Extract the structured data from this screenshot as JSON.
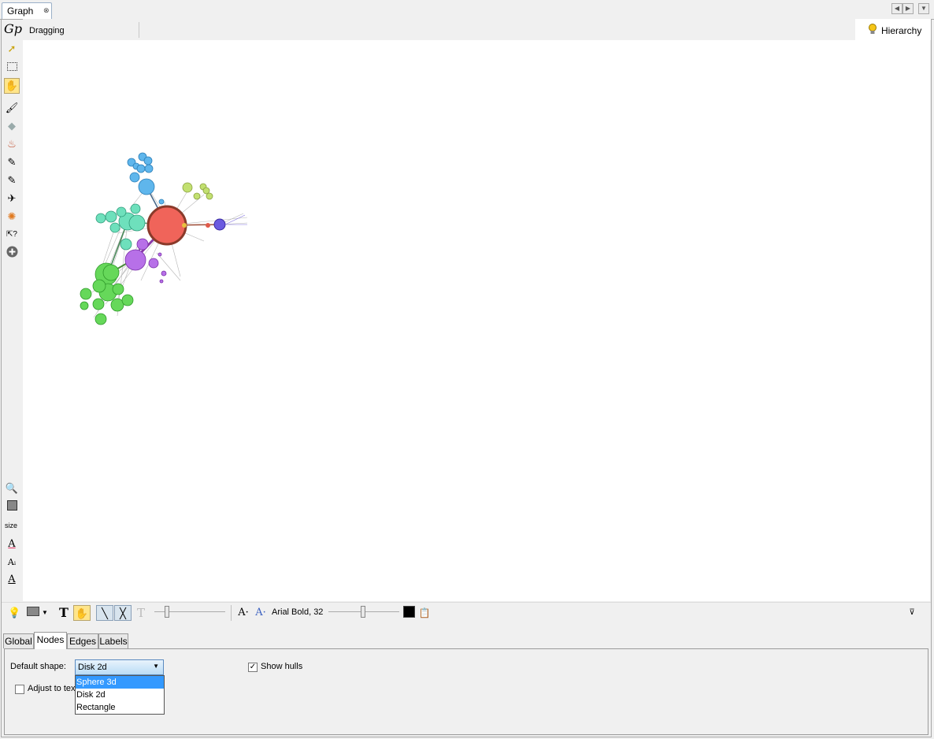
{
  "window": {
    "tab_label": "Graph",
    "close_glyph": "⊗"
  },
  "status": {
    "mode": "Dragging",
    "hierarchy_label": "Hierarchy"
  },
  "left_toolbar": {
    "logo": "Gp",
    "size_label": "size",
    "tools": [
      "pointer-icon",
      "rect-select-icon",
      "drag-hand-icon",
      "brush-icon",
      "diamond-icon",
      "painter-icon",
      "pencil-icon",
      "edge-pencil-icon",
      "plane-icon",
      "sun-icon",
      "help-pointer-icon",
      "plus-circle-icon"
    ],
    "bottom_tools": [
      "zoom-icon",
      "square-color-icon",
      "font-color-icon",
      "font-size-icon",
      "font-label-icon"
    ]
  },
  "bottom_toolbar": {
    "font_label": "Arial Bold, 32",
    "text_color": "#000000"
  },
  "tabs": [
    "Global",
    "Nodes",
    "Edges",
    "Labels"
  ],
  "active_tab": "Nodes",
  "nodes_panel": {
    "default_shape_label": "Default shape:",
    "default_shape_value": "Disk 2d",
    "shape_options": [
      "Sphere 3d",
      "Disk 2d",
      "Rectangle"
    ],
    "highlighted_option": "Sphere 3d",
    "adjust_label": "Adjust to tex",
    "adjust_checked": false,
    "show_hulls_label": "Show hulls",
    "show_hulls_checked": true
  },
  "graph_colors": {
    "red": "#f0645a",
    "blue": "#5fb6ec",
    "teal": "#6ee0bc",
    "purple": "#b770e8",
    "green": "#66d85a",
    "lime": "#c2e070",
    "indigo": "#6a5ae0"
  }
}
